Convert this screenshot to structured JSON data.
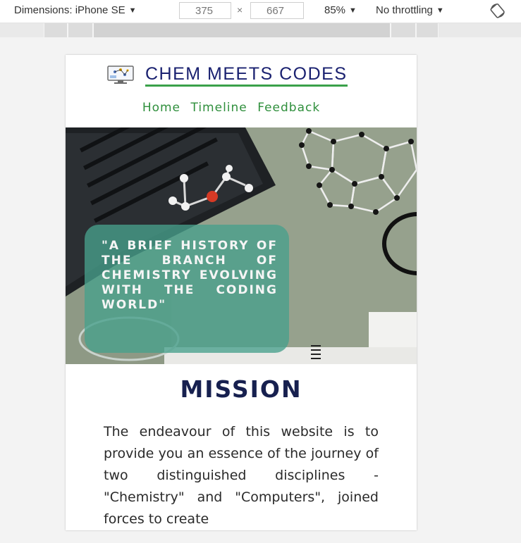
{
  "devtools": {
    "dimensions_label": "Dimensions: iPhone SE",
    "width": "375",
    "times": "×",
    "height": "667",
    "zoom": "85%",
    "throttling": "No throttling",
    "icons": [
      "caret-down-icon",
      "rotate-icon"
    ]
  },
  "site": {
    "title": "CHEM MEETS CODES",
    "nav": [
      "Home",
      "Timeline",
      "Feedback"
    ],
    "hero_quote": "\"A brief history of the branch of chemistry evolving with the coding world\"",
    "mission_heading": "MISSION",
    "mission_text": "The endeavour of this website is to provide you an essence of the journey of two distinguished disciplines - \"Chemistry\" and \"Computers\", joined forces to create",
    "colors": {
      "title": "#1a2170",
      "nav": "#2f8f3c",
      "quote_box": "#48a08c",
      "heading": "#17204f"
    }
  }
}
